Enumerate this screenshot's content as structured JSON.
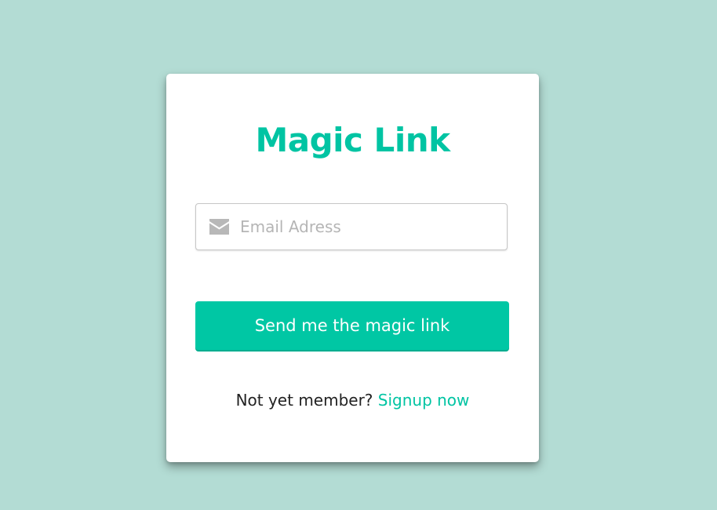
{
  "colors": {
    "background": "#b3dcd4",
    "accent": "#00c7a4",
    "card": "#ffffff"
  },
  "card": {
    "title": "Magic Link",
    "email_field": {
      "icon": "envelope-icon",
      "placeholder": "Email Adress",
      "value": ""
    },
    "send_button_label": "Send me the magic link",
    "footer": {
      "prompt": "Not yet member?",
      "signup_link": "Signup now"
    }
  }
}
